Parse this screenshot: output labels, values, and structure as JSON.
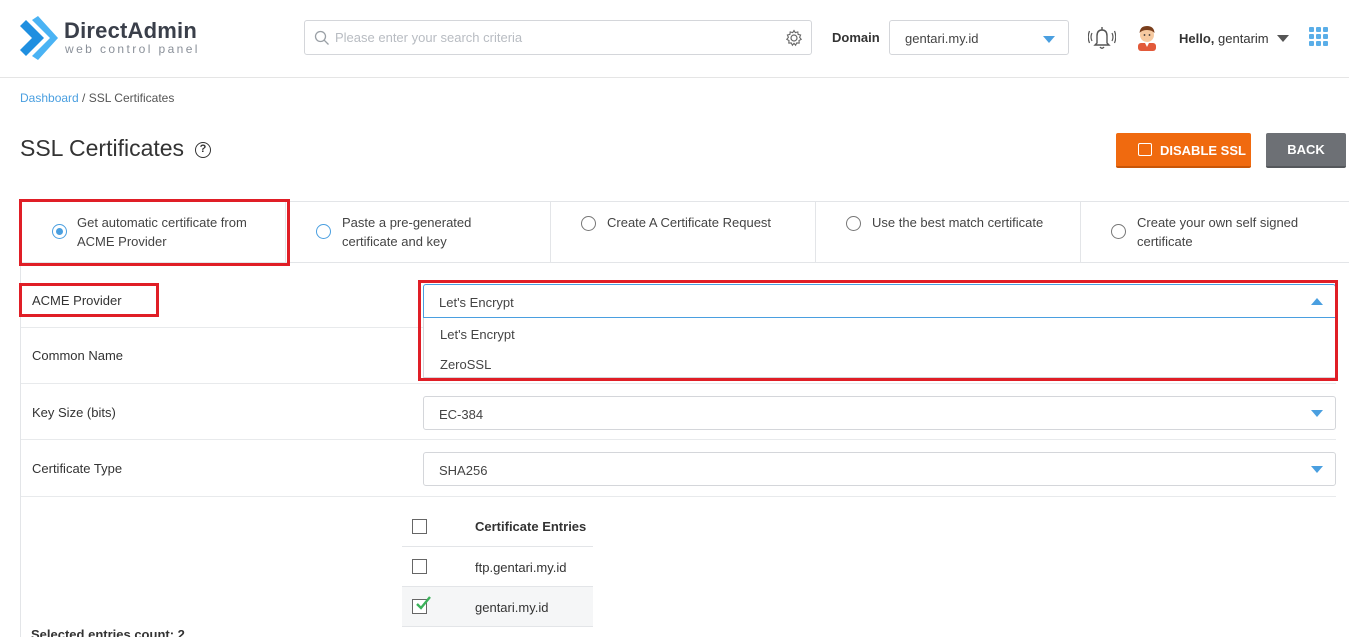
{
  "header": {
    "logo_name": "DirectAdmin",
    "logo_sub": "web control panel",
    "search_placeholder": "Please enter your search criteria",
    "domain_label": "Domain",
    "domain_value": "gentari.my.id",
    "hello": "Hello,",
    "username": "gentarim"
  },
  "breadcrumb": {
    "home": "Dashboard",
    "separator": " / ",
    "current": "SSL Certificates"
  },
  "page": {
    "title": "SSL Certificates",
    "help": "?",
    "disable_ssl_label": "DISABLE SSL",
    "back_label": "BACK"
  },
  "tabs": [
    {
      "label_line1": "Get automatic certificate from",
      "label_line2": "ACME Provider",
      "selected": true
    },
    {
      "label_line1": "Paste a pre-generated",
      "label_line2": "certificate and key",
      "selected": false
    },
    {
      "label_line1": "Create A Certificate Request",
      "label_line2": "",
      "selected": false
    },
    {
      "label_line1": "Use the best match certificate",
      "label_line2": "",
      "selected": false
    },
    {
      "label_line1": "Create your own self signed",
      "label_line2": "certificate",
      "selected": false
    }
  ],
  "form": {
    "acme_provider_label": "ACME Provider",
    "acme_provider_value": "Let's Encrypt",
    "acme_provider_options": [
      "Let's Encrypt",
      "ZeroSSL"
    ],
    "common_name_label": "Common Name",
    "key_size_label": "Key Size (bits)",
    "key_size_value": "EC-384",
    "cert_type_label": "Certificate Type",
    "cert_type_value": "SHA256"
  },
  "entries": {
    "header": "Certificate Entries",
    "rows": [
      {
        "name": "ftp.gentari.my.id",
        "checked": false
      },
      {
        "name": "gentari.my.id",
        "checked": true
      }
    ],
    "selected_count": "Selected entries count: 2"
  },
  "colors": {
    "accent": "#4a9fe0",
    "orange": "#f06a0f",
    "highlight": "#e01e26"
  }
}
